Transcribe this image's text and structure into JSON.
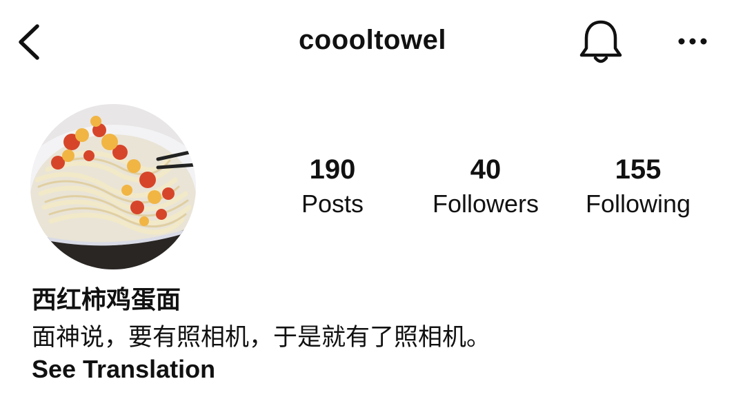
{
  "header": {
    "username": "coooltowel",
    "back_icon": "chevron-left-icon",
    "notification_icon": "bell-icon",
    "more_icon": "more-horizontal-icon"
  },
  "profile": {
    "avatar_icon": "avatar-noodles-image",
    "stats": [
      {
        "value": "190",
        "label": "Posts"
      },
      {
        "value": "40",
        "label": "Followers"
      },
      {
        "value": "155",
        "label": "Following"
      }
    ],
    "display_name": "西红柿鸡蛋面",
    "bio": "面神说，要有照相机，于是就有了照相机。",
    "see_translation": "See Translation"
  }
}
